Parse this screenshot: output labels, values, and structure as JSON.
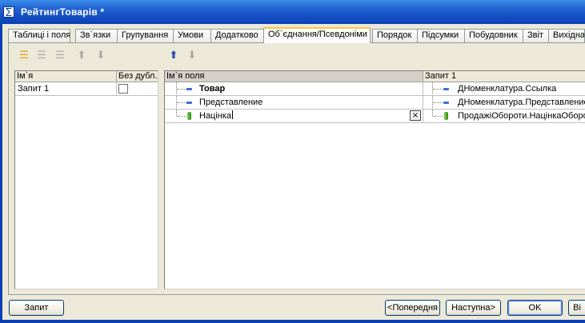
{
  "window": {
    "title": "РейтингТоварів *",
    "sys_icon": "∑"
  },
  "tabs": [
    {
      "label": "Таблиці і поля"
    },
    {
      "label": "Зв`язки"
    },
    {
      "label": "Групування"
    },
    {
      "label": "Умови"
    },
    {
      "label": "Додатково"
    },
    {
      "label": "Об`єднання/Псевдоніми",
      "active": true
    },
    {
      "label": "Порядок"
    },
    {
      "label": "Підсумки"
    },
    {
      "label": "Побудовник"
    },
    {
      "label": "Звіт"
    },
    {
      "label": "Вихідна"
    }
  ],
  "icons": {
    "add_query": "add-query-icon",
    "copy_query": "copy-query-icon",
    "delete_query": "delete-query-icon",
    "move_up": "move-up-icon",
    "move_down": "move-down-icon",
    "field_up": "field-up-icon",
    "field_down": "field-down-icon"
  },
  "queries_table": {
    "headers": {
      "name": "Ім`я",
      "no_duplicates": "Без дубл."
    },
    "rows": [
      {
        "name": "Запит 1",
        "no_duplicates": false
      }
    ]
  },
  "fields_table": {
    "headers": {
      "field_name": "Ім`я поля",
      "query": "Запит 1"
    },
    "rows": [
      {
        "field_name": "Товар",
        "source": "ДНоменклатура.Ссылка",
        "bold": true
      },
      {
        "field_name": "Представление",
        "source": "ДНоменклатура.Представление"
      },
      {
        "field_name": "Націнка",
        "source": "ПродажіОбороти.НацінкаОборот",
        "editing": true
      }
    ],
    "clear_label": "×"
  },
  "buttons": {
    "query": "Запит",
    "previous": "<Попередня",
    "next": "Наступна>",
    "ok": "OK",
    "last": "Ві"
  },
  "colors": {
    "title_bar": "#0a3fb5",
    "active_tab_accent": "#ffc83c",
    "face": "#ece9d8"
  }
}
